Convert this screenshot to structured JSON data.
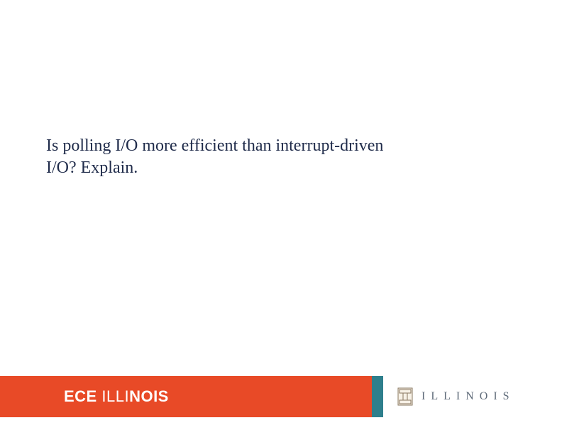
{
  "content": {
    "question": "Is polling I/O more efficient than interrupt-driven I/O? Explain."
  },
  "footer": {
    "dept_prefix": "ECE ",
    "dept_thin": "ILLI",
    "dept_bold": "NOIS",
    "wordmark_full": "ILLINOIS"
  }
}
